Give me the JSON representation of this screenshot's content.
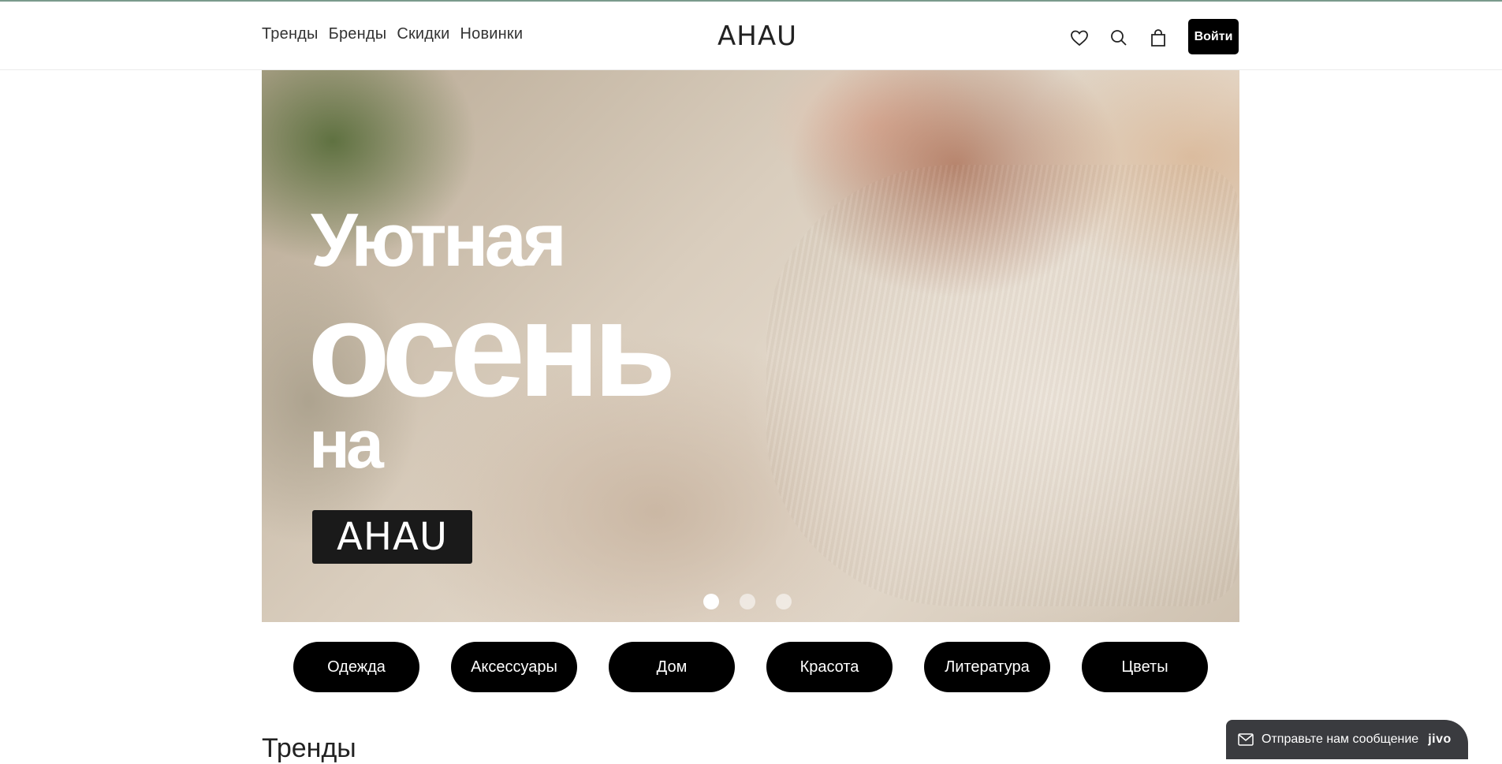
{
  "header": {
    "nav": [
      "Тренды",
      "Бренды",
      "Скидки",
      "Новинки"
    ],
    "logo": "AHAU",
    "icons": [
      "heart-icon",
      "search-icon",
      "bag-icon"
    ],
    "login_label": "Войти"
  },
  "hero": {
    "line1": "Уютная",
    "line2": "осень",
    "line3": "на",
    "badge": "AHAU",
    "slides_total": 3,
    "active_slide": 1
  },
  "categories": [
    "Одежда",
    "Аксессуары",
    "Дом",
    "Красота",
    "Литература",
    "Цветы"
  ],
  "section_title": "Тренды",
  "chat": {
    "text": "Отправьте нам сообщение",
    "brand": "jivo",
    "icon": "mail-icon"
  },
  "colors": {
    "accent": "#000000",
    "chat_bg": "#3a3b3f"
  }
}
